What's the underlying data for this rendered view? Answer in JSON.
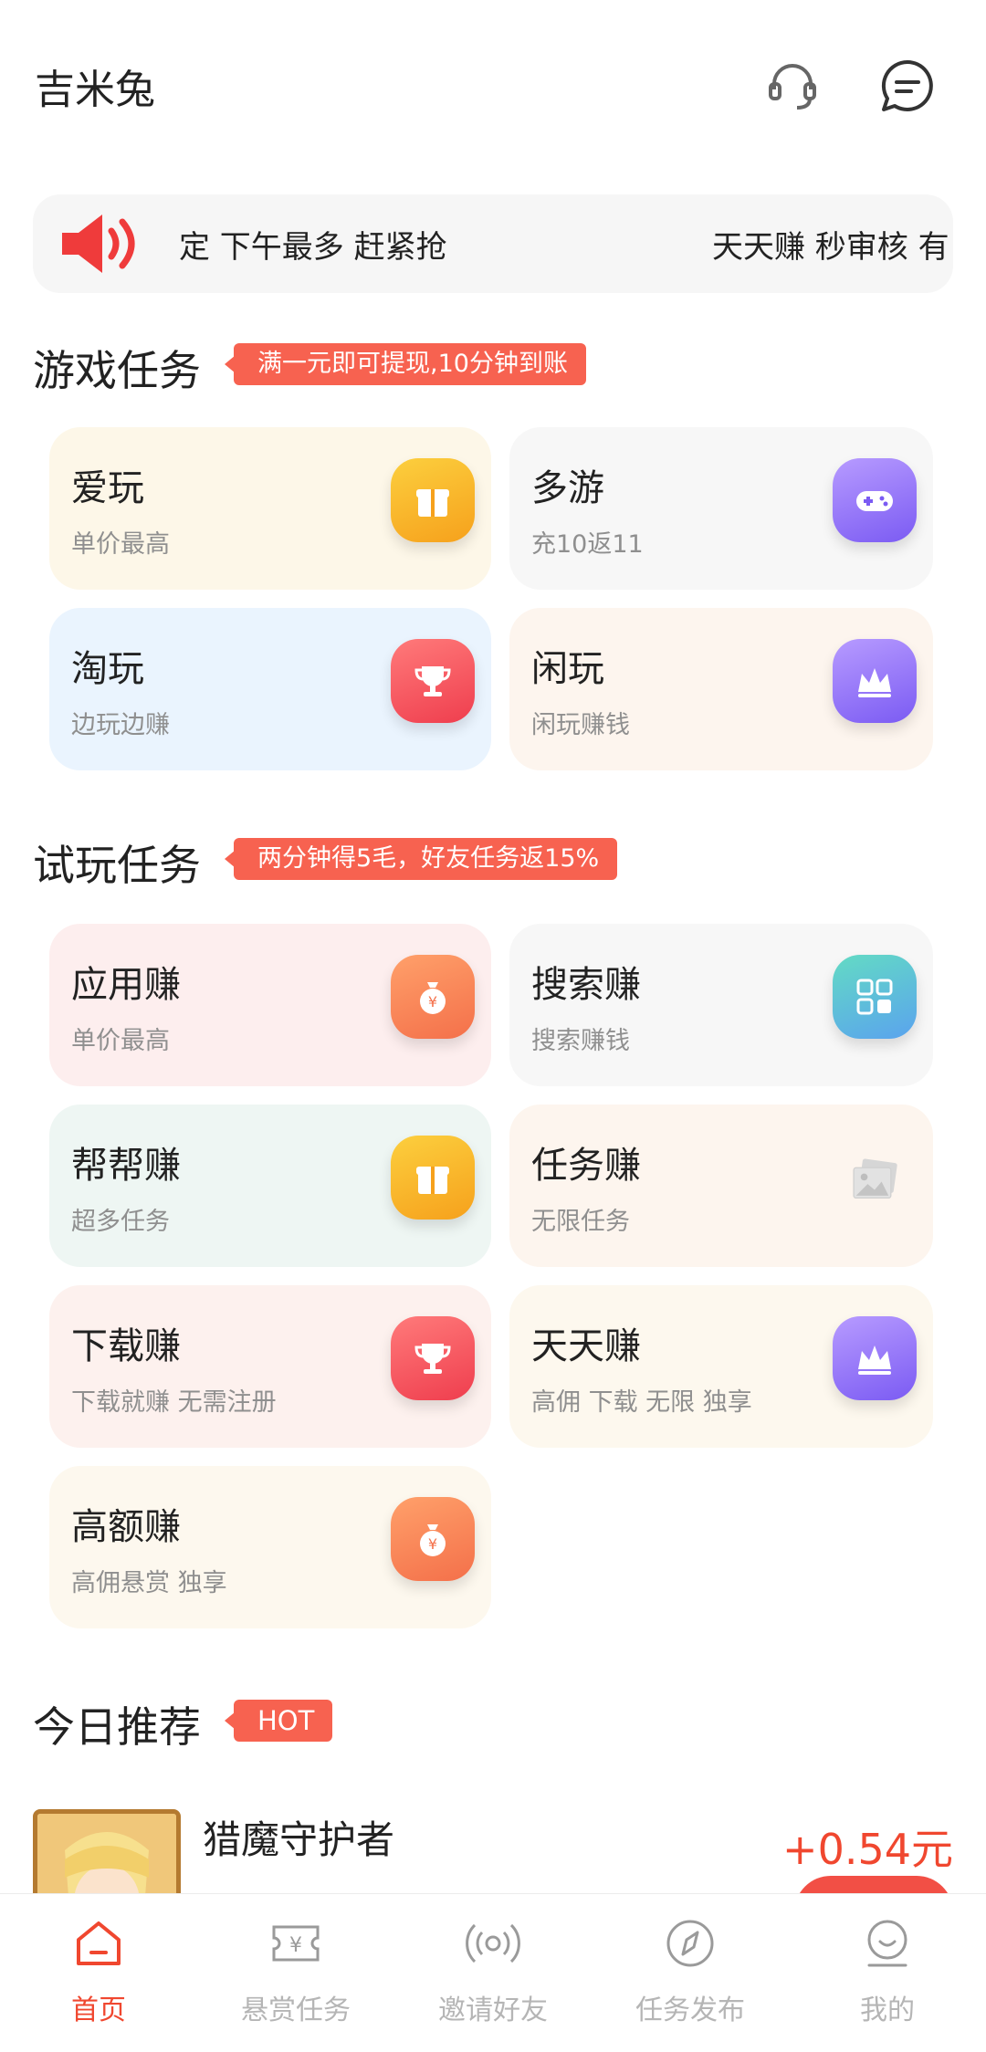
{
  "header": {
    "title": "吉米兔",
    "support_icon": "headset-icon",
    "message_icon": "message-icon"
  },
  "notice": {
    "text_left": "定 下午最多 赶紧抢",
    "text_right": "天天赚 秒审核 有"
  },
  "game_section": {
    "title": "游戏任务",
    "badge": "满一元即可提现,10分钟到账",
    "cards": [
      {
        "title": "爱玩",
        "subtitle": "单价最高",
        "icon": "gift-icon"
      },
      {
        "title": "多游",
        "subtitle": "充10返11",
        "icon": "gamepad-icon"
      },
      {
        "title": "淘玩",
        "subtitle": "边玩边赚",
        "icon": "trophy-icon"
      },
      {
        "title": "闲玩",
        "subtitle": "闲玩赚钱",
        "icon": "crown-icon"
      }
    ]
  },
  "trial_section": {
    "title": "试玩任务",
    "badge": "两分钟得5毛，好友任务返15%",
    "cards": [
      {
        "title": "应用赚",
        "subtitle": "单价最高",
        "icon": "money-bag-icon"
      },
      {
        "title": "搜索赚",
        "subtitle": "搜索赚钱",
        "icon": "grid-apps-icon"
      },
      {
        "title": "帮帮赚",
        "subtitle": "超多任务",
        "icon": "gift-icon"
      },
      {
        "title": "任务赚",
        "subtitle": "无限任务",
        "icon": "image-placeholder-icon"
      },
      {
        "title": "下载赚",
        "subtitle": "下载就赚 无需注册",
        "icon": "trophy-icon"
      },
      {
        "title": "天天赚",
        "subtitle": "高佣 下载 无限 独享",
        "icon": "crown-icon"
      },
      {
        "title": "高额赚",
        "subtitle": "高佣悬赏 独享",
        "icon": "money-bag-icon"
      }
    ]
  },
  "recommend_section": {
    "title": "今日推荐",
    "badge": "HOT",
    "item": {
      "name": "猎魔守护者",
      "reward": "+0.54元"
    }
  },
  "tabbar": {
    "tabs": [
      {
        "label": "首页",
        "icon": "home-icon",
        "active": true
      },
      {
        "label": "悬赏任务",
        "icon": "ticket-yen-icon",
        "active": false
      },
      {
        "label": "邀请好友",
        "icon": "broadcast-icon",
        "active": false
      },
      {
        "label": "任务发布",
        "icon": "compass-icon",
        "active": false
      },
      {
        "label": "我的",
        "icon": "profile-icon",
        "active": false
      }
    ]
  },
  "colors": {
    "accent": "#f0472f",
    "badge": "#f76250"
  }
}
